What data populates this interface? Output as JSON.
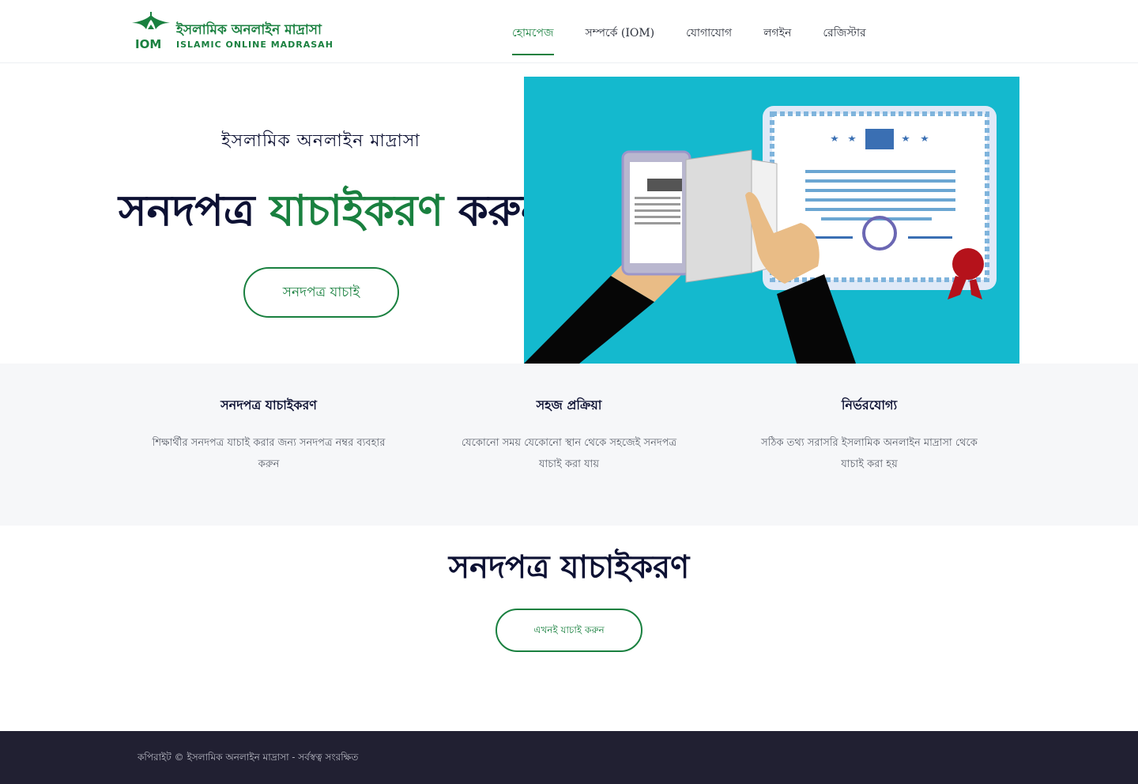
{
  "brand": {
    "name_bn": "ইসলামিক অনলাইন মাদ্রাসা",
    "name_en": "ISLAMIC ONLINE MADRASAH",
    "abbr": "IOM",
    "color": "#19803f"
  },
  "nav": {
    "items": [
      {
        "label": "হোমপেজ",
        "active": true
      },
      {
        "label": "সম্পর্কে (IOM)",
        "active": false
      },
      {
        "label": "যোগাযোগ",
        "active": false
      },
      {
        "label": "লগইন",
        "active": false
      },
      {
        "label": "রেজিস্টার",
        "active": false
      }
    ]
  },
  "hero": {
    "subtitle": "ইসলামিক অনলাইন মাদ্রাসা",
    "title_pre": "সনদপত্র ",
    "title_highlight": "যাচাইকরণ",
    "title_post": " করুন",
    "button_label": "সনদপত্র যাচাই",
    "image_icon": "certificate-verification-illustration"
  },
  "features": [
    {
      "title": "সনদপত্র যাচাইকরণ",
      "desc": "শিক্ষার্থীর সনদপত্র যাচাই করার জন্য সনদপত্র নম্বর ব্যবহার করুন"
    },
    {
      "title": "সহজ প্রক্রিয়া",
      "desc": "যেকোনো সময় যেকোনো স্থান থেকে সহজেই সনদপত্র যাচাই করা যায়"
    },
    {
      "title": "নির্ভরযোগ্য",
      "desc": "সঠিক তথ্য সরাসরি ইসলামিক অনলাইন মাদ্রাসা থেকে যাচাই করা হয়"
    }
  ],
  "section": {
    "title": "সনদপত্র যাচাইকরণ",
    "button_label": "এখনই যাচাই করুন"
  },
  "footer": {
    "text": "কপিরাইট © ইসলামিক অনলাইন মাদ্রাসা - সর্বস্বত্ব সংরক্ষিত"
  }
}
